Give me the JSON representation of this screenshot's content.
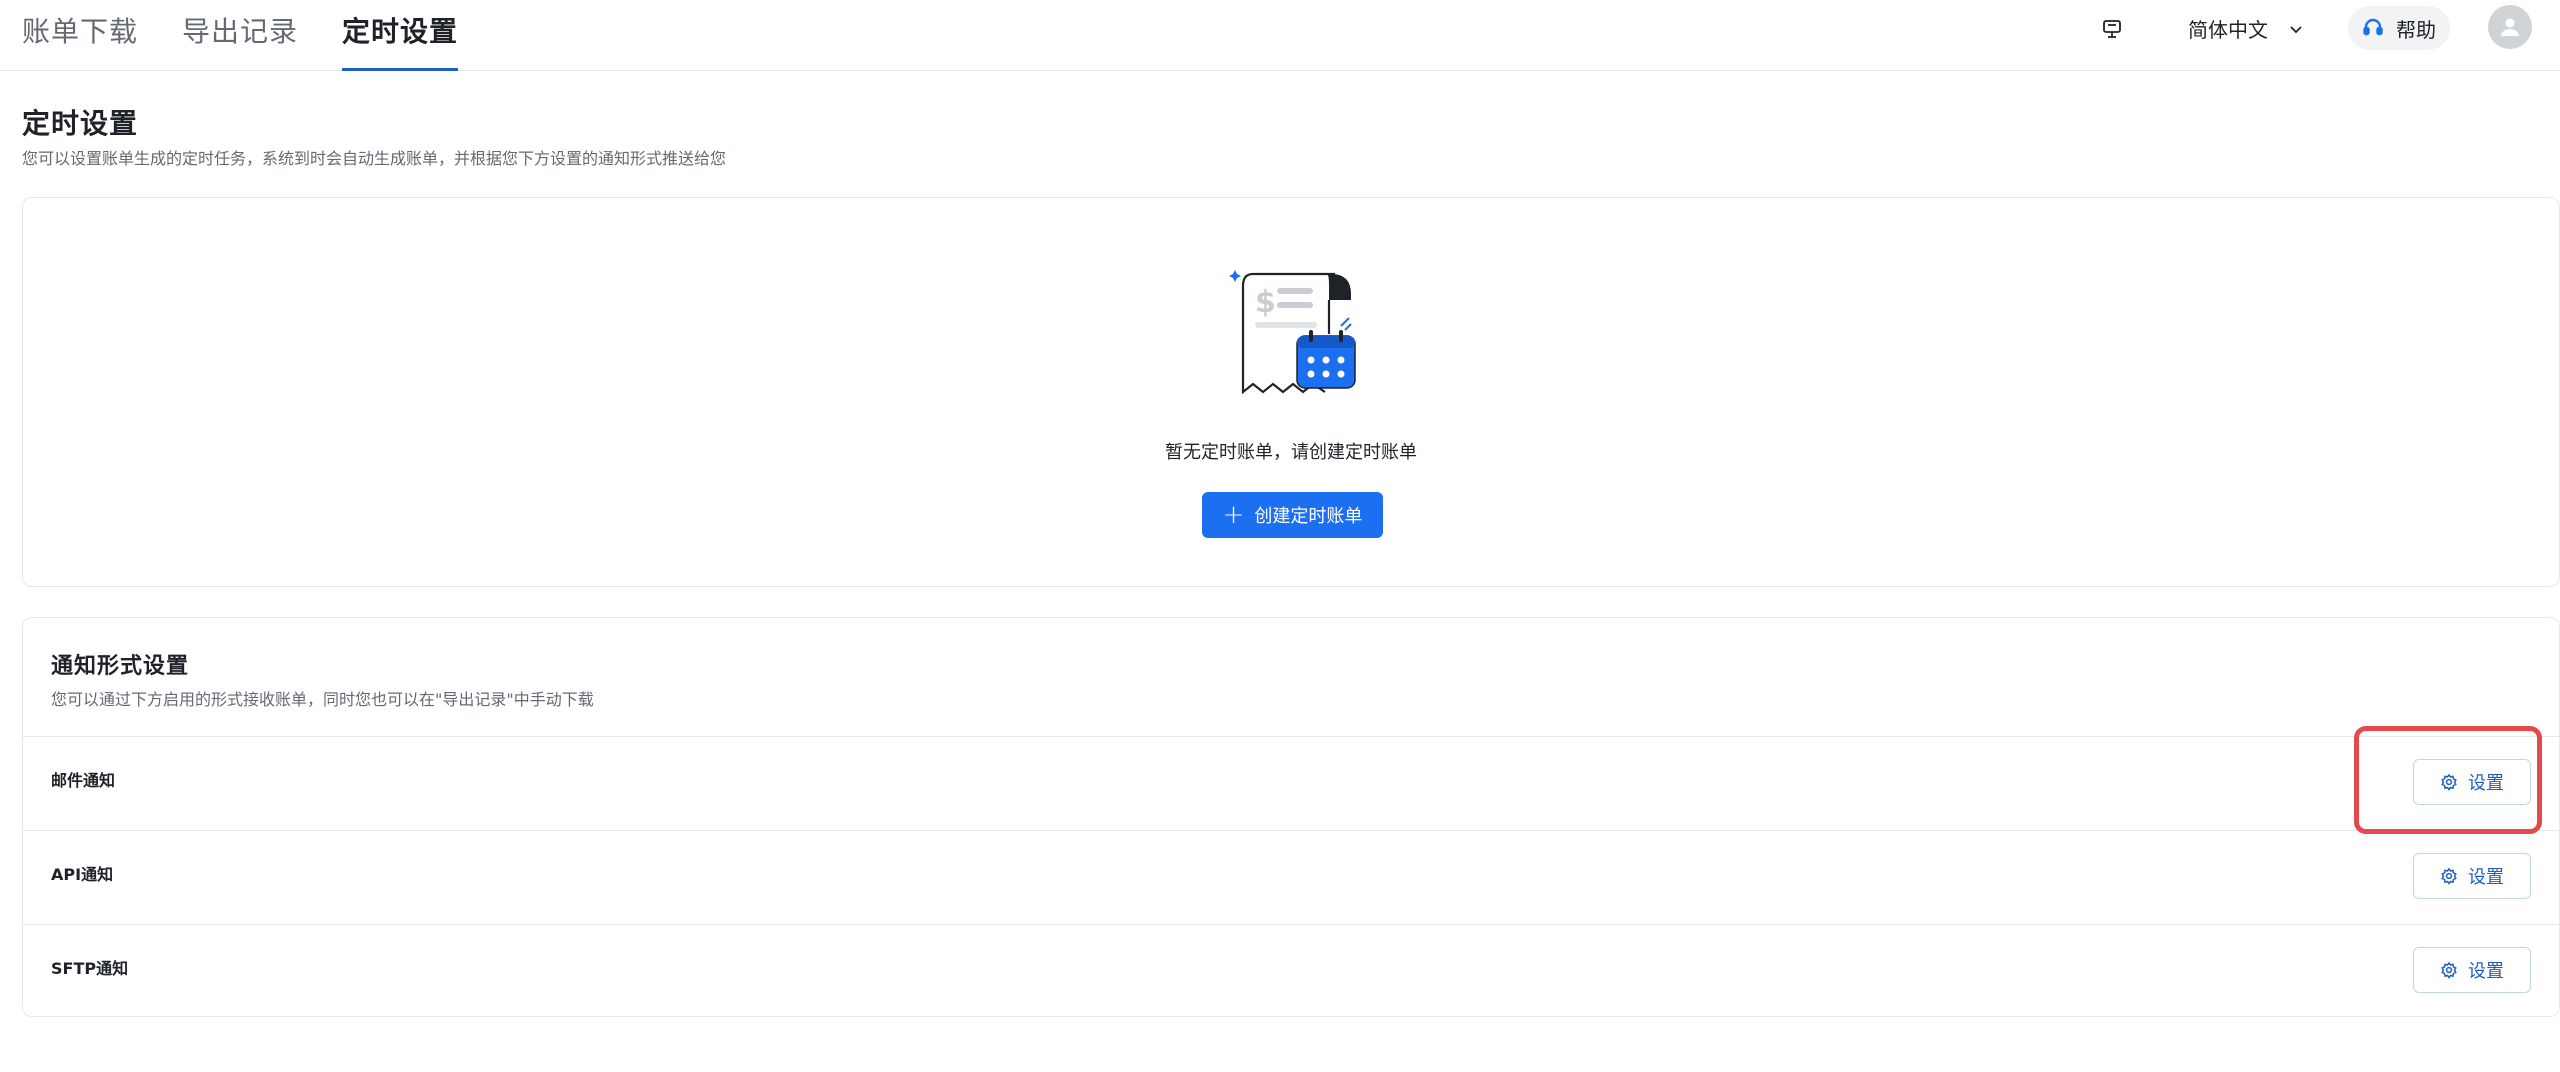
{
  "header": {
    "tabs": [
      {
        "label": "账单下载",
        "active": false
      },
      {
        "label": "导出记录",
        "active": false
      },
      {
        "label": "定时设置",
        "active": true
      }
    ],
    "language": "简体中文",
    "help_label": "帮助",
    "icons": [
      "monitor-icon",
      "chevron-down-icon",
      "headset-icon",
      "user-icon"
    ]
  },
  "page": {
    "title": "定时设置",
    "description": "您可以设置账单生成的定时任务，系统到时会自动生成账单，并根据您下方设置的通知形式推送给您"
  },
  "empty_state": {
    "message": "暂无定时账单，请创建定时账单",
    "create_button": "创建定时账单"
  },
  "notify": {
    "title": "通知形式设置",
    "description": "您可以通过下方启用的形式接收账单，同时您也可以在\"导出记录\"中手动下载",
    "rows": [
      {
        "label": "邮件通知",
        "button": "设置"
      },
      {
        "label": "API通知",
        "button": "设置"
      },
      {
        "label": "SFTP通知",
        "button": "设置"
      }
    ]
  },
  "colors": {
    "primary": "#1d6ff2",
    "highlight": "#e5484d",
    "text": "#1f2329",
    "muted": "#646a73"
  }
}
